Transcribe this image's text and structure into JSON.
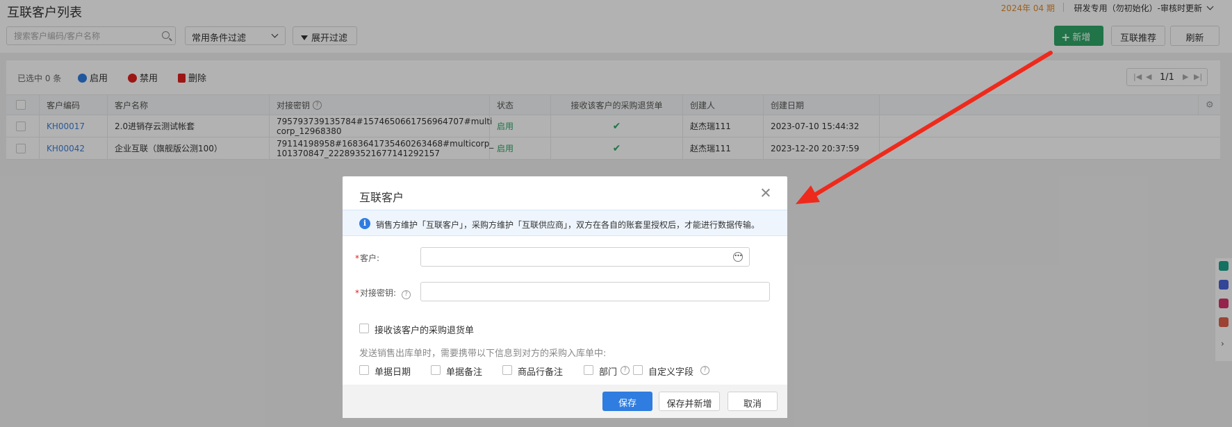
{
  "page": {
    "title": "互联客户列表",
    "period": "2024年 04 期",
    "account": "研发专用（勿初始化）-审核时更新"
  },
  "toolbar": {
    "search_placeholder": "搜索客户编码/客户名称",
    "filter_select": "常用条件过滤",
    "expand_filter": "展开过滤",
    "add": "新增",
    "recommend": "互联推荐",
    "refresh": "刷新"
  },
  "list": {
    "selected": "已选中 0 条",
    "actions": {
      "enable": "启用",
      "disable": "禁用",
      "delete": "删除"
    },
    "pager": "1/1",
    "columns": [
      "客户编码",
      "客户名称",
      "对接密钥",
      "状态",
      "接收该客户的采购退货单",
      "创建人",
      "创建日期"
    ],
    "rows": [
      {
        "code": "KH00017",
        "name": "2.0进销存云测试帐套",
        "key_line1": "795793739135784#1574650661756964707#multi",
        "key_line2": "corp_12968380",
        "status": "启用",
        "receive": "✔",
        "creator": "赵杰瑞111",
        "date": "2023-07-10 15:44:32"
      },
      {
        "code": "KH00042",
        "name": "企业互联（旗舰版公测100）",
        "key_line1": "79114198958#1683641735460263468#multicorp_",
        "key_line2": "101370847_222893521677141292157",
        "status": "启用",
        "receive": "✔",
        "creator": "赵杰瑞111",
        "date": "2023-12-20 20:37:59"
      }
    ]
  },
  "modal": {
    "title": "互联客户",
    "info": "销售方维护「互联客户」，采购方维护「互联供应商」，双方在各自的账套里授权后，才能进行数据传输。",
    "customer_label": "客户:",
    "customer_value": "",
    "key_label": "对接密钥:",
    "key_value": "",
    "receive_checkbox": "接收该客户的采购退货单",
    "hint": "发送销售出库单时，需要携带以下信息到对方的采购入库单中:",
    "options": [
      "单据日期",
      "单据备注",
      "商品行备注",
      "部门",
      "自定义字段"
    ],
    "buttons": {
      "save": "保存",
      "save_new": "保存并新增",
      "cancel": "取消"
    }
  },
  "colors": {
    "primary": "#2f7de1",
    "success": "#2ea768",
    "period": "#e08a2c",
    "arrow": "#ee2a1c",
    "required": "#e02020"
  }
}
